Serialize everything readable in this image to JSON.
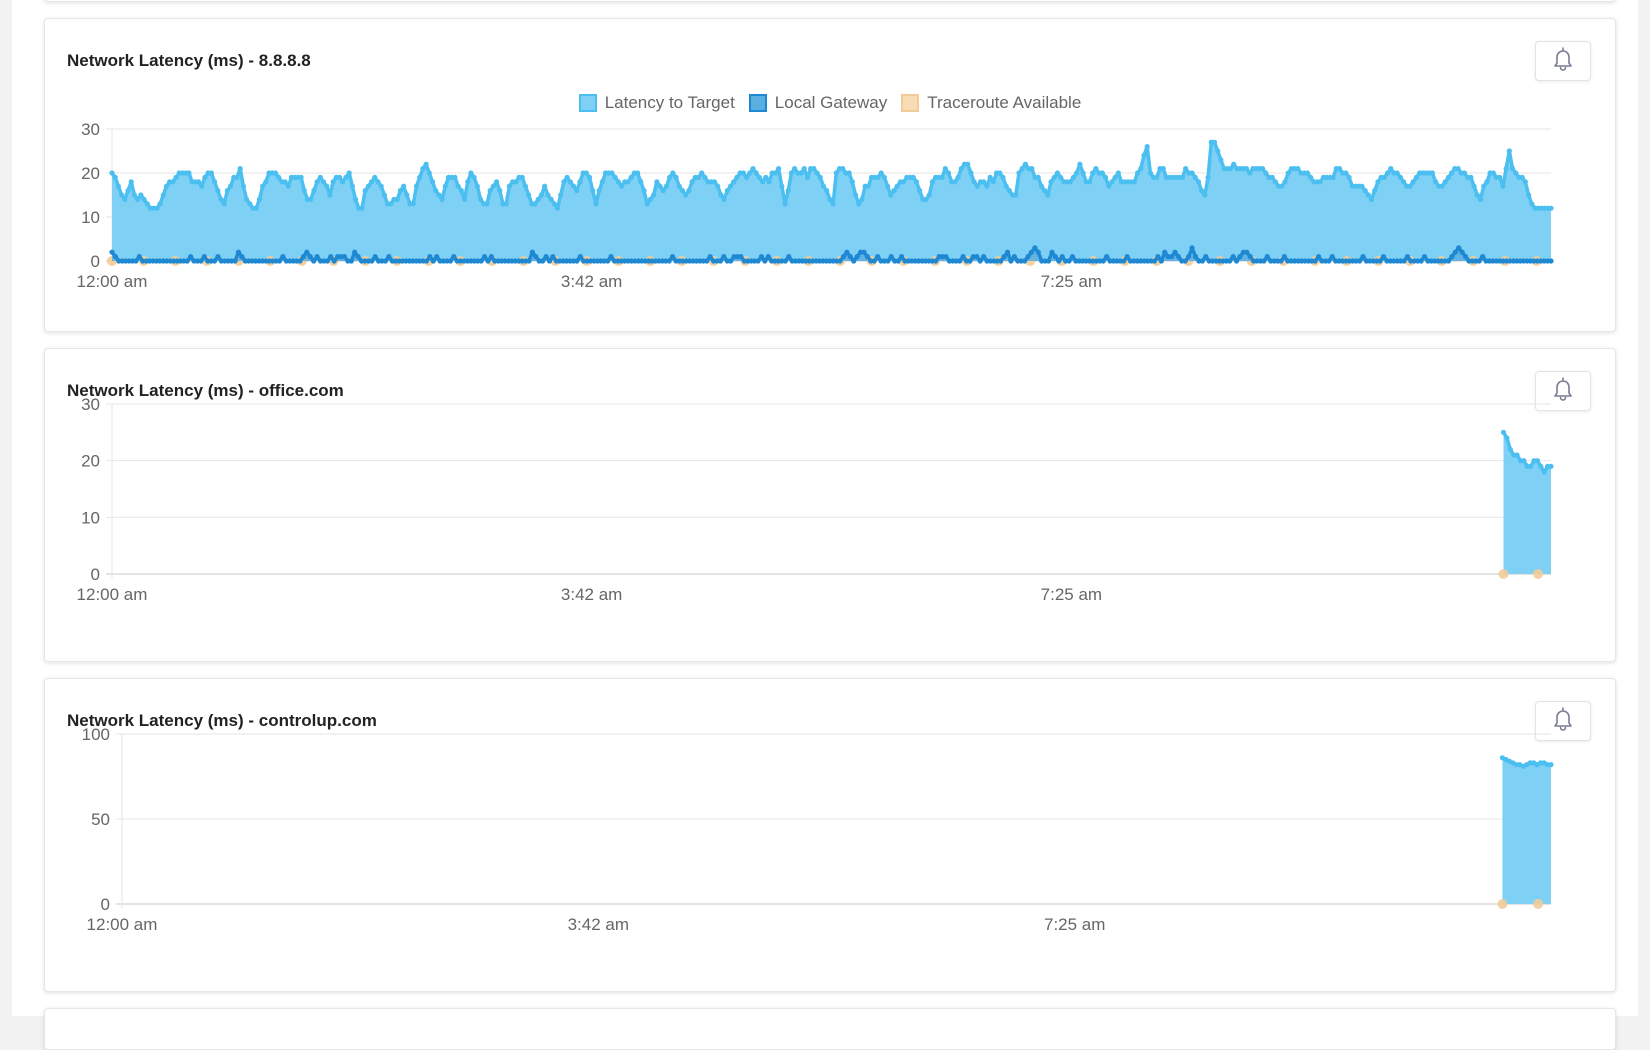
{
  "colors": {
    "latency_fill": "#7fd0f5",
    "latency_line": "#4bbff0",
    "gateway_fill": "#5aaee0",
    "gateway_line": "#1e88d2",
    "traceroute": "#f2cc98",
    "grid": "#e6e6e6",
    "axis": "#c8c8c8",
    "tick_text": "#666666",
    "bell": "#7a7d94"
  },
  "icons": {
    "alert": "bell-icon"
  },
  "chart_data": [
    {
      "type": "area",
      "title": "Network Latency (ms) - 8.8.8.8",
      "xlabel": "",
      "ylabel": "",
      "x_tick_labels": [
        "12:00 am",
        "3:42 am",
        "7:25 am"
      ],
      "x_tick_positions": [
        0,
        0.3333,
        0.6667
      ],
      "y_ticks": [
        0,
        10,
        20,
        30
      ],
      "ylim": [
        0,
        30
      ],
      "grid": true,
      "legend": {
        "placement": "top-center",
        "entries": [
          "Latency to Target",
          "Local Gateway",
          "Traceroute Available"
        ]
      },
      "series": [
        {
          "name": "Latency to Target",
          "kind": "area",
          "x_range": [
            0,
            1
          ],
          "values": [
            20,
            19,
            17,
            15,
            14,
            16,
            18,
            15,
            14,
            15,
            14,
            13,
            12,
            12,
            12,
            13,
            15,
            17,
            18,
            18,
            19,
            20,
            20,
            20,
            20,
            18,
            18,
            18,
            17,
            19,
            20,
            20,
            18,
            16,
            14,
            13,
            16,
            17,
            19,
            19,
            21,
            17,
            14,
            13,
            12,
            12,
            14,
            17,
            18,
            20,
            20,
            20,
            19,
            18,
            18,
            17,
            19,
            19,
            19,
            19,
            16,
            14,
            14,
            16,
            18,
            19,
            18,
            17,
            15,
            18,
            19,
            19,
            18,
            19,
            20,
            17,
            14,
            12,
            12,
            16,
            17,
            18,
            19,
            18,
            17,
            15,
            13,
            13,
            14,
            14,
            16,
            17,
            15,
            13,
            13,
            17,
            19,
            21,
            22,
            20,
            18,
            16,
            15,
            14,
            17,
            19,
            19,
            19,
            17,
            16,
            14,
            18,
            20,
            19,
            17,
            14,
            13,
            13,
            16,
            17,
            18,
            16,
            13,
            13,
            17,
            18,
            18,
            19,
            19,
            17,
            15,
            13,
            13,
            14,
            15,
            17,
            15,
            14,
            13,
            12,
            15,
            18,
            19,
            18,
            17,
            16,
            18,
            20,
            20,
            19,
            16,
            13,
            16,
            18,
            20,
            20,
            20,
            19,
            18,
            17,
            18,
            18,
            19,
            20,
            20,
            18,
            16,
            13,
            14,
            15,
            18,
            17,
            16,
            17,
            19,
            20,
            19,
            17,
            16,
            15,
            16,
            18,
            19,
            19,
            20,
            19,
            18,
            18,
            18,
            17,
            15,
            14,
            16,
            17,
            18,
            19,
            20,
            20,
            19,
            20,
            21,
            20,
            19,
            18,
            19,
            18,
            20,
            20,
            21,
            17,
            13,
            16,
            20,
            21,
            20,
            20,
            21,
            19,
            21,
            21,
            20,
            19,
            17,
            16,
            14,
            13,
            20,
            21,
            21,
            20,
            20,
            18,
            15,
            13,
            14,
            17,
            17,
            19,
            19,
            19,
            20,
            19,
            17,
            15,
            16,
            17,
            18,
            18,
            19,
            19,
            19,
            18,
            16,
            14,
            14,
            15,
            18,
            19,
            19,
            19,
            21,
            20,
            18,
            18,
            19,
            21,
            22,
            22,
            20,
            18,
            17,
            18,
            18,
            17,
            19,
            18,
            20,
            20,
            19,
            17,
            16,
            15,
            15,
            20,
            21,
            22,
            21,
            21,
            19,
            19,
            17,
            16,
            15,
            18,
            19,
            20,
            19,
            18,
            18,
            18,
            19,
            20,
            22,
            20,
            18,
            18,
            20,
            21,
            20,
            20,
            19,
            17,
            18,
            19,
            20,
            18,
            18,
            18,
            18,
            18,
            20,
            21,
            24,
            26,
            20,
            19,
            19,
            21,
            21,
            19,
            19,
            19,
            19,
            19,
            19,
            21,
            20,
            20,
            19,
            18,
            16,
            15,
            19,
            27,
            27,
            25,
            23,
            21,
            21,
            21,
            22,
            21,
            21,
            21,
            21,
            20,
            21,
            21,
            21,
            21,
            20,
            19,
            19,
            18,
            17,
            17,
            18,
            20,
            21,
            21,
            21,
            20,
            20,
            20,
            19,
            18,
            18,
            18,
            19,
            19,
            19,
            19,
            21,
            21,
            20,
            20,
            19,
            17,
            17,
            17,
            17,
            16,
            15,
            14,
            16,
            18,
            19,
            19,
            20,
            21,
            20,
            20,
            19,
            18,
            17,
            17,
            18,
            19,
            20,
            20,
            20,
            20,
            20,
            18,
            17,
            17,
            18,
            19,
            20,
            21,
            21,
            20,
            20,
            19,
            19,
            17,
            15,
            14,
            17,
            18,
            20,
            20,
            19,
            19,
            17,
            21,
            25,
            21,
            20,
            19,
            19,
            18,
            15,
            13,
            12,
            12,
            12,
            12,
            12,
            12
          ]
        },
        {
          "name": "Local Gateway",
          "kind": "line",
          "x_range": [
            0,
            1
          ],
          "values": [
            2,
            1,
            0,
            0,
            0,
            0,
            0,
            0,
            1,
            0,
            0,
            0,
            0,
            0,
            0,
            0,
            0,
            0,
            0,
            0,
            0,
            0,
            0,
            1,
            0,
            0,
            0,
            1,
            0,
            0,
            0,
            1,
            0,
            0,
            0,
            0,
            0,
            2,
            1,
            0,
            0,
            0,
            0,
            0,
            0,
            0,
            0,
            0,
            0,
            0,
            1,
            0,
            0,
            0,
            0,
            0,
            1,
            2,
            1,
            0,
            1,
            0,
            0,
            0,
            1,
            0,
            1,
            1,
            1,
            0,
            0,
            2,
            1,
            0,
            0,
            0,
            0,
            1,
            0,
            0,
            0,
            1,
            0,
            0,
            0,
            0,
            0,
            0,
            0,
            0,
            0,
            0,
            0,
            1,
            0,
            1,
            0,
            0,
            0,
            0,
            1,
            0,
            0,
            0,
            0,
            0,
            0,
            0,
            0,
            1,
            0,
            1,
            0,
            0,
            0,
            0,
            0,
            0,
            0,
            0,
            0,
            0,
            0,
            2,
            1,
            0,
            0,
            1,
            0,
            1,
            0,
            0,
            0,
            0,
            0,
            0,
            0,
            1,
            0,
            0,
            0,
            0,
            0,
            0,
            0,
            0,
            1,
            0,
            0,
            0,
            0,
            0,
            0,
            0,
            0,
            0,
            0,
            0,
            0,
            0,
            0,
            0,
            0,
            0,
            1,
            0,
            0,
            0,
            0,
            0,
            0,
            0,
            0,
            0,
            0,
            1,
            0,
            0,
            0,
            1,
            0,
            0,
            1,
            1,
            1,
            0,
            0,
            0,
            0,
            0,
            1,
            0,
            1,
            0,
            0,
            0,
            0,
            0,
            1,
            0,
            0,
            0,
            0,
            0,
            0,
            0,
            0,
            0,
            0,
            0,
            0,
            0,
            0,
            0,
            1,
            2,
            1,
            0,
            1,
            2,
            2,
            1,
            0,
            0,
            1,
            0,
            0,
            0,
            1,
            0,
            0,
            1,
            0,
            0,
            0,
            0,
            0,
            0,
            0,
            0,
            0,
            0,
            1,
            1,
            1,
            0,
            0,
            0,
            0,
            1,
            0,
            0,
            1,
            1,
            0,
            1,
            0,
            0,
            0,
            0,
            0,
            1,
            2,
            0,
            1,
            0,
            0,
            0,
            1,
            2,
            3,
            2,
            0,
            0,
            0,
            2,
            1,
            0,
            1,
            0,
            0,
            1,
            0,
            0,
            0,
            0,
            0,
            0,
            0,
            0,
            0,
            1,
            0,
            0,
            0,
            0,
            0,
            1,
            0,
            0,
            0,
            0,
            0,
            0,
            0,
            0,
            1,
            0,
            2,
            1,
            1,
            2,
            1,
            0,
            0,
            1,
            3,
            1,
            0,
            0,
            1,
            0,
            0,
            0,
            0,
            0,
            0,
            0,
            1,
            0,
            1,
            2,
            2,
            1,
            0,
            0,
            0,
            0,
            1,
            0,
            0,
            0,
            0,
            1,
            0,
            0,
            0,
            0,
            0,
            0,
            0,
            0,
            0,
            1,
            0,
            0,
            0,
            1,
            0,
            0,
            0,
            0,
            0,
            0,
            0,
            0,
            1,
            0,
            0,
            0,
            0,
            0,
            1,
            0,
            0,
            0,
            0,
            0,
            0,
            1,
            0,
            0,
            0,
            0,
            1,
            0,
            0,
            0,
            0,
            0,
            0,
            0,
            1,
            2,
            3,
            2,
            1,
            0,
            0,
            0,
            0,
            1,
            0,
            0,
            0,
            0,
            0,
            0,
            0,
            0,
            0,
            0,
            0,
            0,
            0,
            0,
            0,
            0,
            0,
            0,
            0,
            0
          ]
        },
        {
          "name": "Traceroute Available",
          "kind": "points",
          "x": [
            0,
            0.022,
            0.044,
            0.066,
            0.088,
            0.11,
            0.132,
            0.154,
            0.176,
            0.198,
            0.22,
            0.242,
            0.264,
            0.286,
            0.308,
            0.33,
            0.352,
            0.374,
            0.396,
            0.418,
            0.44,
            0.462,
            0.484,
            0.506,
            0.528,
            0.55,
            0.572,
            0.594,
            0.616,
            0.638,
            0.66,
            0.682,
            0.704,
            0.726,
            0.748,
            0.77,
            0.792,
            0.814,
            0.836,
            0.858,
            0.88,
            0.902,
            0.924,
            0.946,
            0.968,
            0.99
          ],
          "values": [
            0,
            0,
            0,
            0,
            0,
            0,
            0,
            0,
            0,
            0,
            0,
            0,
            0,
            0,
            0,
            0,
            0,
            0,
            0,
            0,
            0,
            0,
            0,
            0,
            0,
            0,
            0,
            0,
            0,
            0,
            0,
            0,
            0,
            0,
            0,
            0,
            0,
            0,
            0,
            0,
            0,
            0,
            0,
            0,
            0,
            0
          ]
        }
      ]
    },
    {
      "type": "area",
      "title": "Network Latency (ms) - office.com",
      "xlabel": "",
      "ylabel": "",
      "x_tick_labels": [
        "12:00 am",
        "3:42 am",
        "7:25 am"
      ],
      "x_tick_positions": [
        0,
        0.3333,
        0.6667
      ],
      "y_ticks": [
        0,
        10,
        20,
        30
      ],
      "ylim": [
        0,
        30
      ],
      "grid": true,
      "legend": null,
      "series": [
        {
          "name": "Latency to Target",
          "kind": "area",
          "x_range": [
            0.967,
            1
          ],
          "values": [
            25,
            24,
            22,
            21,
            21,
            20,
            20,
            19,
            19,
            20,
            20,
            19,
            18,
            19,
            19
          ]
        },
        {
          "name": "Traceroute Available",
          "kind": "points",
          "x": [
            0.967,
            0.991
          ],
          "values": [
            0,
            0
          ]
        }
      ]
    },
    {
      "type": "area",
      "title": "Network Latency (ms) - controlup.com",
      "xlabel": "",
      "ylabel": "",
      "x_tick_labels": [
        "12:00 am",
        "3:42 am",
        "7:25 am"
      ],
      "x_tick_positions": [
        0,
        0.3333,
        0.6667
      ],
      "y_ticks": [
        0,
        50,
        100
      ],
      "ylim": [
        0,
        100
      ],
      "grid": true,
      "legend": null,
      "series": [
        {
          "name": "Latency to Target",
          "kind": "area",
          "x_range": [
            0.966,
            1
          ],
          "values": [
            86,
            85,
            84,
            83,
            82,
            82,
            81,
            82,
            83,
            83,
            82,
            83,
            83,
            82,
            82
          ]
        },
        {
          "name": "Traceroute Available",
          "kind": "points",
          "x": [
            0.966,
            0.991
          ],
          "values": [
            0,
            0
          ]
        }
      ]
    }
  ]
}
